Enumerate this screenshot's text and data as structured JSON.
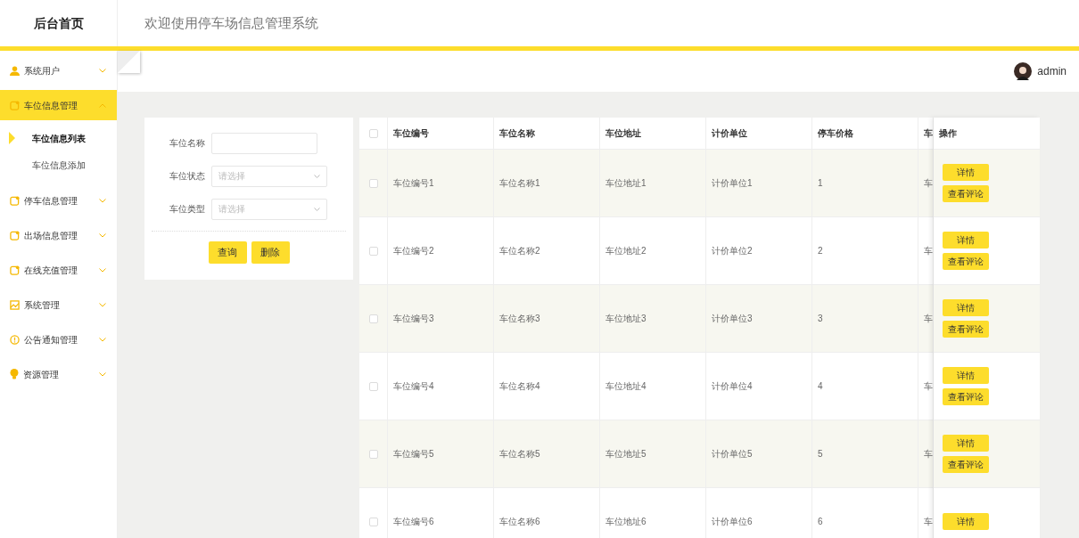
{
  "header": {
    "home": "后台首页",
    "title": "欢迎使用停车场信息管理系统"
  },
  "user": {
    "name": "admin"
  },
  "sidebar": {
    "items": [
      {
        "label": "系统用户",
        "kind": "user",
        "selected": false,
        "expanded": false
      },
      {
        "label": "车位信息管理",
        "kind": "note",
        "selected": true,
        "expanded": true,
        "children": [
          {
            "label": "车位信息列表",
            "selected": true
          },
          {
            "label": "车位信息添加",
            "selected": false
          }
        ]
      },
      {
        "label": "停车信息管理",
        "kind": "note",
        "selected": false,
        "expanded": false
      },
      {
        "label": "出场信息管理",
        "kind": "note",
        "selected": false,
        "expanded": false
      },
      {
        "label": "在线充值管理",
        "kind": "note",
        "selected": false,
        "expanded": false
      },
      {
        "label": "系统管理",
        "kind": "image",
        "selected": false,
        "expanded": false
      },
      {
        "label": "公告通知管理",
        "kind": "alert",
        "selected": false,
        "expanded": false
      },
      {
        "label": "资源管理",
        "kind": "bulb",
        "selected": false,
        "expanded": false
      }
    ]
  },
  "filter": {
    "fields": [
      {
        "kind": "text",
        "label": "车位名称"
      },
      {
        "kind": "select",
        "label": "车位状态",
        "placeholder": "请选择"
      },
      {
        "kind": "select",
        "label": "车位类型",
        "placeholder": "请选择"
      }
    ],
    "buttons": [
      "查询",
      "删除"
    ]
  },
  "table": {
    "header_checked": false,
    "columns": [
      "车位编号",
      "车位名称",
      "车位地址",
      "计价单位",
      "停车价格",
      "车"
    ],
    "action_column": "操作",
    "rows": [
      {
        "checked": false,
        "cells": [
          "车位编号1",
          "车位名称1",
          "车位地址1",
          "计价单位1",
          "1",
          "车"
        ],
        "actions": [
          "详情",
          "查看评论"
        ]
      },
      {
        "checked": false,
        "cells": [
          "车位编号2",
          "车位名称2",
          "车位地址2",
          "计价单位2",
          "2",
          "车"
        ],
        "actions": [
          "详情",
          "查看评论"
        ]
      },
      {
        "checked": false,
        "cells": [
          "车位编号3",
          "车位名称3",
          "车位地址3",
          "计价单位3",
          "3",
          "车"
        ],
        "actions": [
          "详情",
          "查看评论"
        ]
      },
      {
        "checked": false,
        "cells": [
          "车位编号4",
          "车位名称4",
          "车位地址4",
          "计价单位4",
          "4",
          "车"
        ],
        "actions": [
          "详情",
          "查看评论"
        ]
      },
      {
        "checked": false,
        "cells": [
          "车位编号5",
          "车位名称5",
          "车位地址5",
          "计价单位5",
          "5",
          "车"
        ],
        "actions": [
          "详情",
          "查看评论"
        ]
      },
      {
        "checked": false,
        "cells": [
          "车位编号6",
          "车位名称6",
          "车位地址6",
          "计价单位6",
          "6",
          "车"
        ],
        "actions": [
          "详情"
        ]
      }
    ]
  }
}
